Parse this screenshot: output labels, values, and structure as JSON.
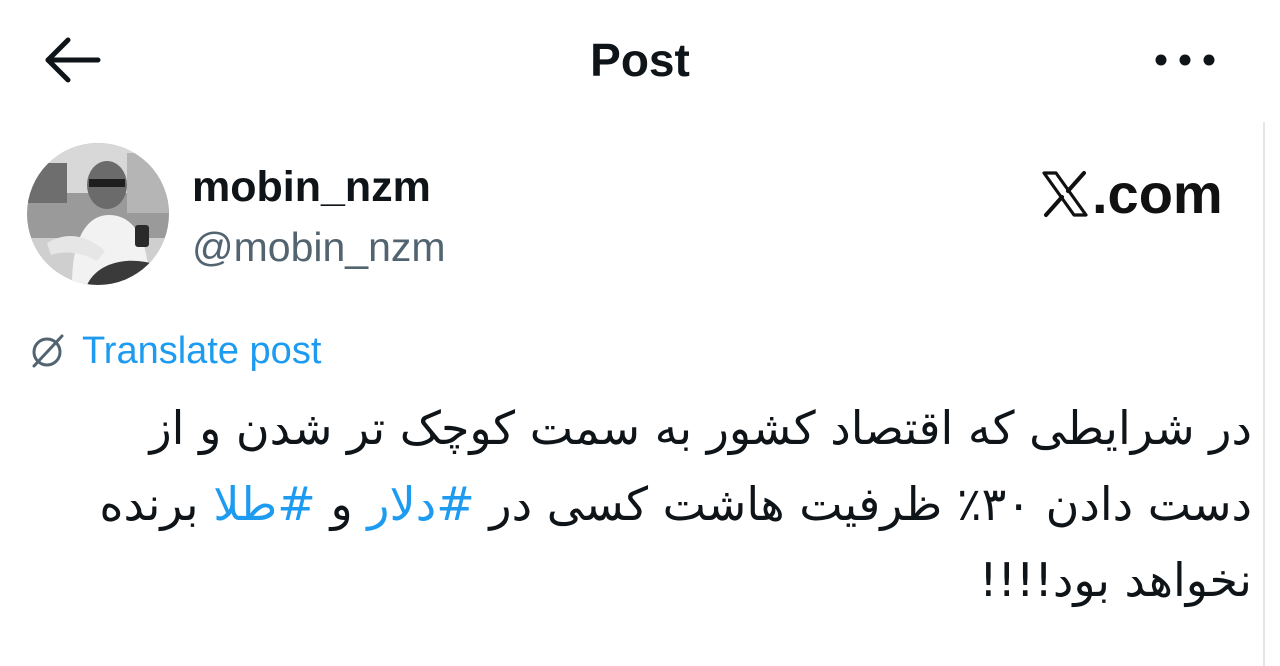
{
  "header": {
    "title": "Post",
    "back_icon": "arrow-left-icon",
    "more_icon": "ellipsis-icon"
  },
  "author": {
    "display_name": "mobin_nzm",
    "handle": "@mobin_nzm"
  },
  "watermark": {
    "logo_icon": "x-logo-icon",
    "text": ".com"
  },
  "translate": {
    "icon": "translate-globe-icon",
    "label": "Translate post"
  },
  "post": {
    "line1": "در شرایطی که اقتصاد کشور به سمت کوچک تر شدن و از",
    "line2_a": "دست دادن ۳۰٪ ظرفیت هاشت کسی در ",
    "hashtag_1": "#دلار",
    "line2_b": " و ",
    "hashtag_2": "#طلا",
    "line2_c": " برنده",
    "line3": "نخواهد بود!!!!"
  },
  "colors": {
    "text": "#0f1419",
    "secondary": "#536471",
    "link": "#1d9bf0",
    "background": "#ffffff"
  }
}
